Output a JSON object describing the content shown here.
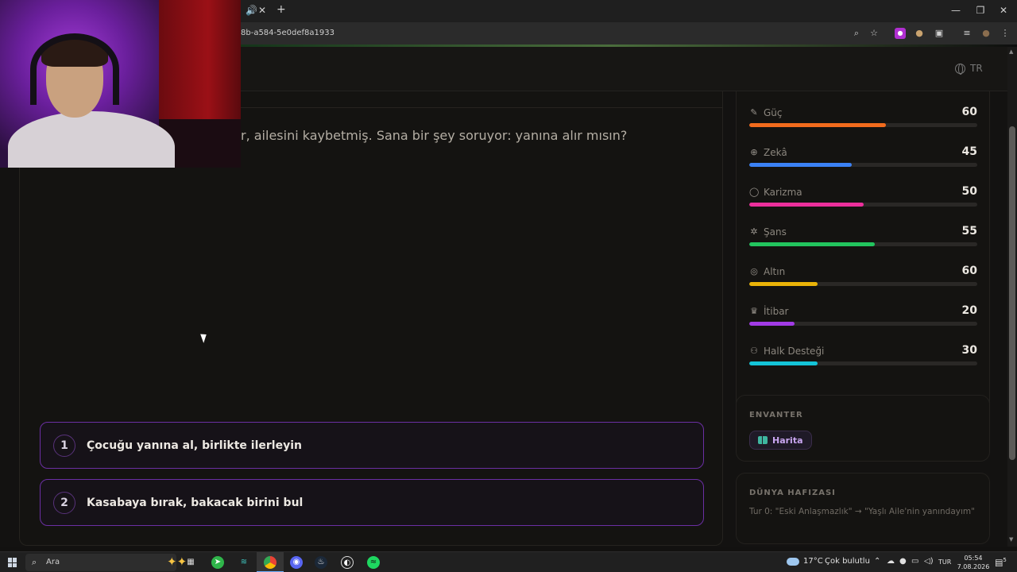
{
  "browser": {
    "url": "8b-a584-5e0def8a1933",
    "tab_controls": {
      "mute": "🔊",
      "close": "✕",
      "new_tab": "+"
    },
    "window_controls": {
      "minimize": "—",
      "restore": "❐",
      "close": "✕"
    },
    "toolbar_icons": [
      "zoom-icon",
      "star-icon",
      "extension-icon",
      "profile-icon",
      "puzzle-icon",
      "media-icon",
      "avatar-icon",
      "menu-icon"
    ]
  },
  "header": {
    "language": "TR"
  },
  "story": {
    "text": "r, ailesini kaybetmiş. Sana bir şey soruyor: yanına alır mısın?"
  },
  "choices": [
    {
      "number": "1",
      "label": "Çocuğu yanına al, birlikte ilerleyin"
    },
    {
      "number": "2",
      "label": "Kasabaya bırak, bakacak birini bul"
    }
  ],
  "stats": [
    {
      "name": "Güç",
      "value": "60",
      "max": 100,
      "color": "#f26b1d",
      "icon": "power-icon"
    },
    {
      "name": "Zekâ",
      "value": "45",
      "max": 100,
      "color": "#3b82f6",
      "icon": "brain-icon"
    },
    {
      "name": "Karizma",
      "value": "50",
      "max": 100,
      "color": "#ec2f9c",
      "icon": "speech-icon"
    },
    {
      "name": "Şans",
      "value": "55",
      "max": 100,
      "color": "#22c55e",
      "icon": "clover-icon"
    },
    {
      "name": "Altın",
      "value": "60",
      "max": 200,
      "color": "#eab308",
      "icon": "coin-icon"
    },
    {
      "name": "İtibar",
      "value": "20",
      "max": 100,
      "color": "#a23be6",
      "icon": "crown-icon"
    },
    {
      "name": "Halk Desteği",
      "value": "30",
      "max": 100,
      "color": "#14c4d8",
      "icon": "people-icon"
    }
  ],
  "inventory": {
    "title": "ENVANTER",
    "items": [
      {
        "label": "Harita",
        "icon": "book-icon"
      }
    ]
  },
  "memory": {
    "title": "DÜNYA HAFIZASI",
    "entry": "Tur 0: \"Eski Anlaşmazlık\" → \"Yaşlı Aile'nin yanındayım\""
  },
  "taskbar": {
    "search_placeholder": "Ara",
    "weather_temp": "17°C",
    "weather_desc": "Çok bulutlu",
    "language": "TUR",
    "time": "05:54",
    "date": "7.08.2026",
    "notification_count": "5"
  }
}
